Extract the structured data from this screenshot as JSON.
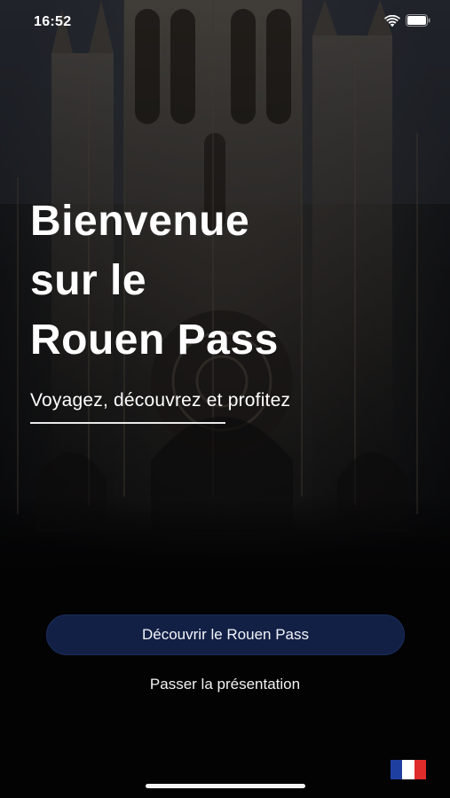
{
  "status_bar": {
    "time": "16:52",
    "icons": [
      "wifi-icon",
      "battery-icon"
    ]
  },
  "hero": {
    "title": "Bienvenue\nsur le\nRouen Pass",
    "subtitle": "Voyagez, découvrez et profitez"
  },
  "actions": {
    "primary_label": "Découvrir le Rouen Pass",
    "skip_label": "Passer la présentation"
  },
  "language": {
    "icon": "french-flag-icon",
    "colors": [
      "#1f3fa0",
      "#ffffff",
      "#e02b2b"
    ]
  },
  "colors": {
    "button_background": "#122046",
    "text": "#ffffff",
    "background": "#050608"
  }
}
